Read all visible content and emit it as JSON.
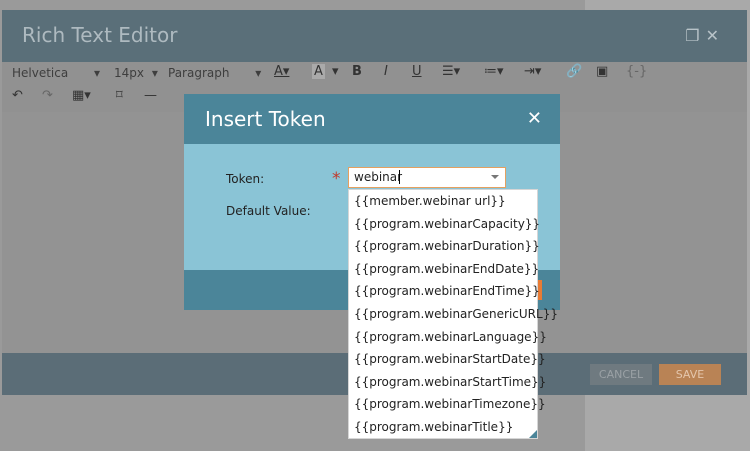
{
  "editor": {
    "title": "Rich Text Editor",
    "window_icons": [
      "restore-icon",
      "close-icon"
    ],
    "toolbar": {
      "font_family": "Helvetica",
      "font_size": "14px",
      "block_format": "Paragraph",
      "row1_icons": [
        "text-color-icon",
        "highlight-icon",
        "bold-icon",
        "italic-icon",
        "underline-icon",
        "align-icon",
        "bullet-list-icon",
        "indent-icon",
        "link-icon",
        "image-icon",
        "token-icon"
      ],
      "row2_icons": [
        "undo-icon",
        "redo-icon",
        "table-icon",
        "bookmark-icon",
        "horizontal-rule-icon",
        "strikethrough-icon",
        "anchor-icon",
        "special-char-icon",
        "source-icon",
        "clear-format-icon"
      ]
    },
    "footer": {
      "cancel_label": "CANCEL",
      "save_label": "SAVE"
    }
  },
  "modal": {
    "title": "Insert Token",
    "close_icon": "close-icon",
    "token_label": "Token:",
    "default_value_label": "Default Value:",
    "required_marker": "*",
    "token_value": "webinar",
    "tokens": [
      "{{member.webinar url}}",
      "{{program.webinarCapacity}}",
      "{{program.webinarDuration}}",
      "{{program.webinarEndDate}}",
      "{{program.webinarEndTime}}",
      "{{program.webinarGenericURL}}",
      "{{program.webinarLanguage}}",
      "{{program.webinarStartDate}}",
      "{{program.webinarStartTime}}",
      "{{program.webinarTimezone}}",
      "{{program.webinarTitle}}"
    ]
  }
}
